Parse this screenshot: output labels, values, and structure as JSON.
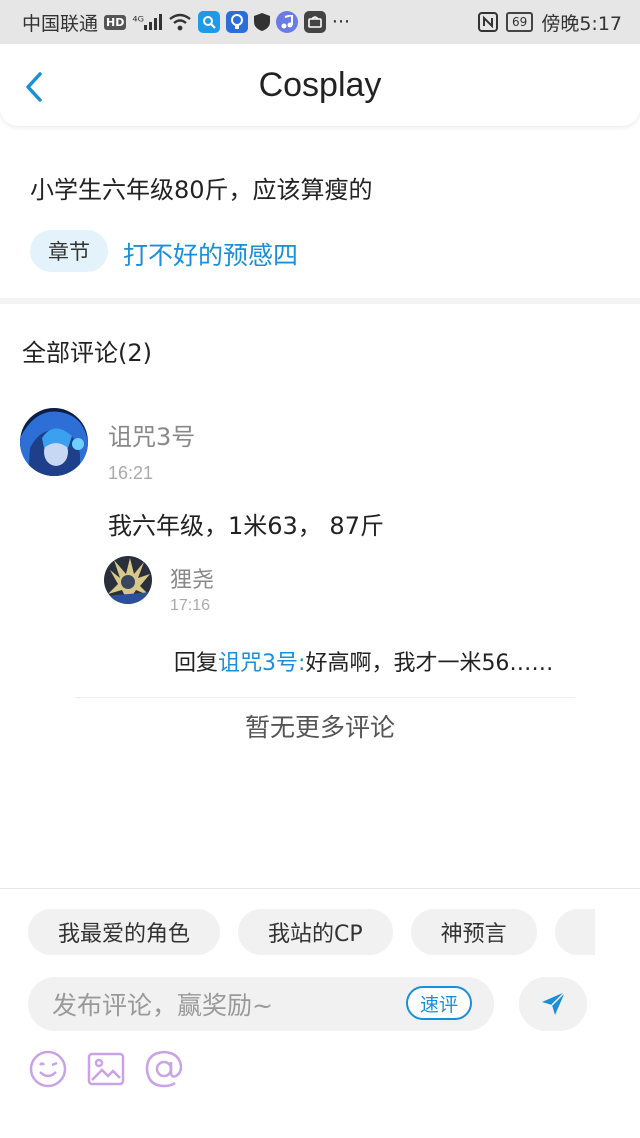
{
  "status_bar": {
    "carrier": "中国联通",
    "hd": "HD",
    "signal": "⁴ᴳ",
    "more": "···",
    "battery": "69",
    "time": "傍晚5:17"
  },
  "header": {
    "title": "Cosplay"
  },
  "post": {
    "text": "小学生六年级80斤，应该算瘦的",
    "chapter_tag": "章节",
    "chapter_title": "打不好的预感四"
  },
  "comments": {
    "heading": "全部评论(2)",
    "items": [
      {
        "name": "诅咒3号",
        "time": "16:21",
        "text": "我六年级，1米63， 87斤",
        "reply": {
          "name": "狸尧",
          "time": "17:16",
          "prefix": "回复",
          "mention": "诅咒3号:",
          "text": "好高啊，我才一米56……"
        }
      }
    ],
    "no_more": "暂无更多评论"
  },
  "composer": {
    "chips": [
      "我最爱的角色",
      "我站的CP",
      "神预言",
      ""
    ],
    "placeholder": "发布评论，赢奖励~",
    "quick_label": "速评"
  },
  "colors": {
    "accent": "#1a8fd8",
    "tool_icon": "#c9a3e6"
  }
}
